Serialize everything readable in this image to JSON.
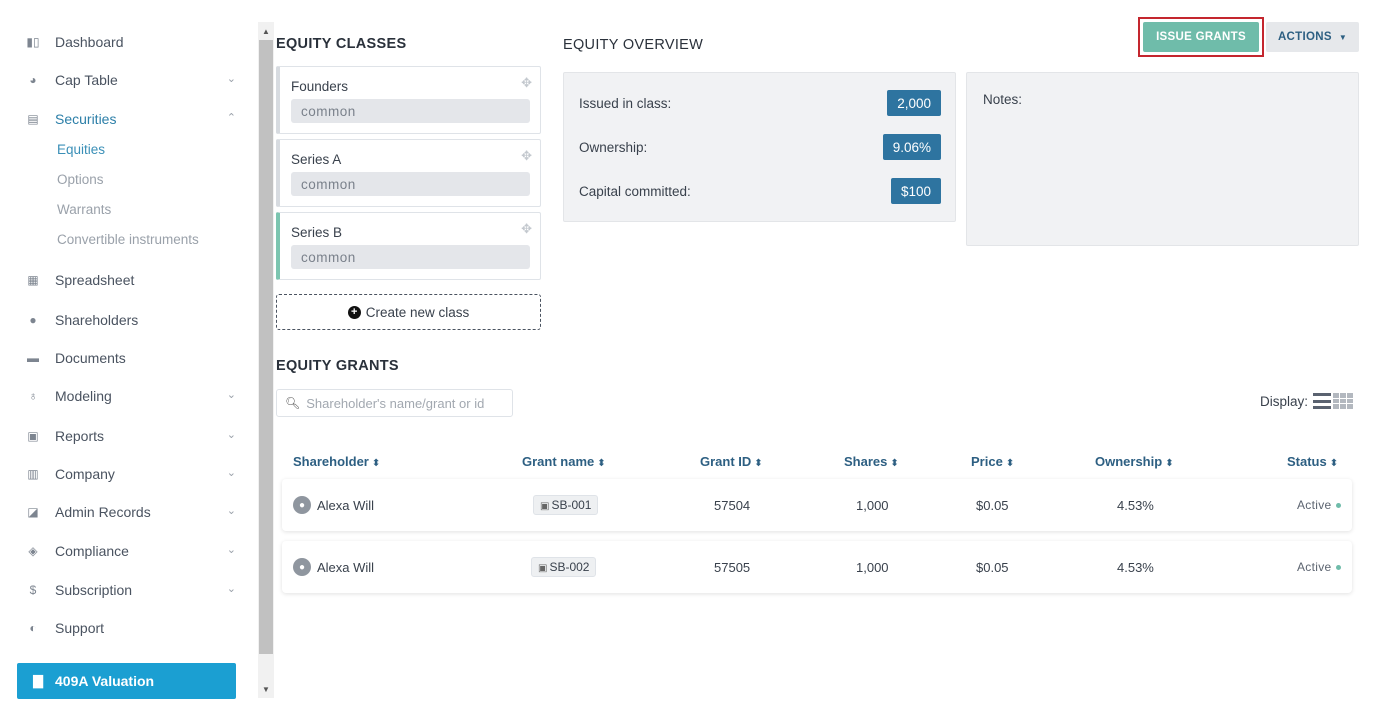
{
  "sidebar": {
    "items": [
      {
        "label": "Dashboard",
        "icon": "dashboard-icon"
      },
      {
        "label": "Cap Table",
        "icon": "pie-chart-icon",
        "chevron": "⌄"
      },
      {
        "label": "Securities",
        "icon": "clipboard-icon",
        "chevron": "⌃"
      },
      {
        "label": "Spreadsheet",
        "icon": "spreadsheet-icon"
      },
      {
        "label": "Shareholders",
        "icon": "user-icon"
      },
      {
        "label": "Documents",
        "icon": "folder-icon"
      },
      {
        "label": "Modeling",
        "icon": "lightbulb-icon",
        "chevron": "⌄"
      },
      {
        "label": "Reports",
        "icon": "reports-icon",
        "chevron": "⌄"
      },
      {
        "label": "Company",
        "icon": "building-icon",
        "chevron": "⌄"
      },
      {
        "label": "Admin Records",
        "icon": "records-icon",
        "chevron": "⌄"
      },
      {
        "label": "Compliance",
        "icon": "shield-check-icon",
        "chevron": "⌄"
      },
      {
        "label": "Subscription",
        "icon": "dollar-icon",
        "chevron": "⌄"
      },
      {
        "label": "Support",
        "icon": "support-icon"
      }
    ],
    "securities_sub": [
      "Equities",
      "Options",
      "Warrants",
      "Convertible instruments"
    ],
    "valuation_label": "409A Valuation"
  },
  "equity_classes": {
    "title": "EQUITY CLASSES",
    "items": [
      {
        "name": "Founders",
        "type": "common"
      },
      {
        "name": "Series A",
        "type": "common"
      },
      {
        "name": "Series B",
        "type": "common"
      }
    ],
    "create_label": "Create new class"
  },
  "overview": {
    "title": "EQUITY OVERVIEW",
    "rows": [
      {
        "label": "Issued in class:",
        "value": "2,000"
      },
      {
        "label": "Ownership:",
        "value": "9.06%"
      },
      {
        "label": "Capital committed:",
        "value": "$100"
      }
    ],
    "notes_label": "Notes:"
  },
  "toolbar": {
    "issue_label": "ISSUE GRANTS",
    "actions_label": "ACTIONS"
  },
  "grants": {
    "title": "EQUITY GRANTS",
    "search_placeholder": "Shareholder's name/grant or id",
    "display_label": "Display:",
    "columns": [
      "Shareholder",
      "Grant name",
      "Grant ID",
      "Shares",
      "Price",
      "Ownership",
      "Status"
    ],
    "rows": [
      {
        "shareholder": "Alexa Will",
        "grant_name": "SB-001",
        "grant_id": "57504",
        "shares": "1,000",
        "price": "$0.05",
        "ownership": "4.53%",
        "status": "Active"
      },
      {
        "shareholder": "Alexa Will",
        "grant_name": "SB-002",
        "grant_id": "57505",
        "shares": "1,000",
        "price": "$0.05",
        "ownership": "4.53%",
        "status": "Active"
      }
    ]
  },
  "colors": {
    "accent_blue": "#1b9fd2",
    "badge_blue": "#2e74a0",
    "issue_green": "#6fbcaa",
    "highlight_red": "#c4262e"
  }
}
